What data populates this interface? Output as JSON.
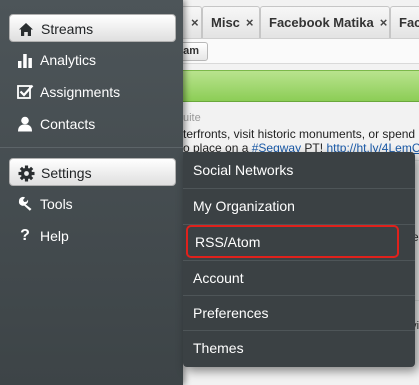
{
  "tabs": [
    {
      "label": "",
      "close": "×"
    },
    {
      "label": "Misc",
      "close": "×"
    },
    {
      "label": "Facebook Matika",
      "close": "×"
    },
    {
      "label": "Fac",
      "close": ""
    }
  ],
  "toolbar": {
    "team_label": "eam"
  },
  "content": {
    "suite_text": "uite",
    "line1": "terfronts, visit historic monuments, or spend",
    "line2_prefix": "o place on a ",
    "line2_hashtag": "#Segway",
    "line2_middle": " PT! ",
    "line2_link": "http://ht.ly/4LemC",
    "right_the": "the",
    "right_plus": "±",
    "right_se": "e vi"
  },
  "main_menu": {
    "items": [
      {
        "label": "Streams",
        "icon": "home-icon"
      },
      {
        "label": "Analytics",
        "icon": "bar-chart-icon"
      },
      {
        "label": "Assignments",
        "icon": "checkbox-icon"
      },
      {
        "label": "Contacts",
        "icon": "person-icon"
      },
      {
        "label": "Settings",
        "icon": "gear-icon"
      },
      {
        "label": "Tools",
        "icon": "wrench-icon"
      },
      {
        "label": "Help",
        "icon": "question-icon"
      }
    ]
  },
  "settings_submenu": {
    "items": [
      {
        "label": "Social Networks"
      },
      {
        "label": "My Organization"
      },
      {
        "label": "RSS/Atom"
      },
      {
        "label": "Account"
      },
      {
        "label": "Preferences"
      },
      {
        "label": "Themes"
      }
    ],
    "highlight_color": "#e0211c"
  },
  "colors": {
    "menu_bg": "#454c50",
    "green_bar": "#8ccd56",
    "link": "#1a5aa8"
  }
}
